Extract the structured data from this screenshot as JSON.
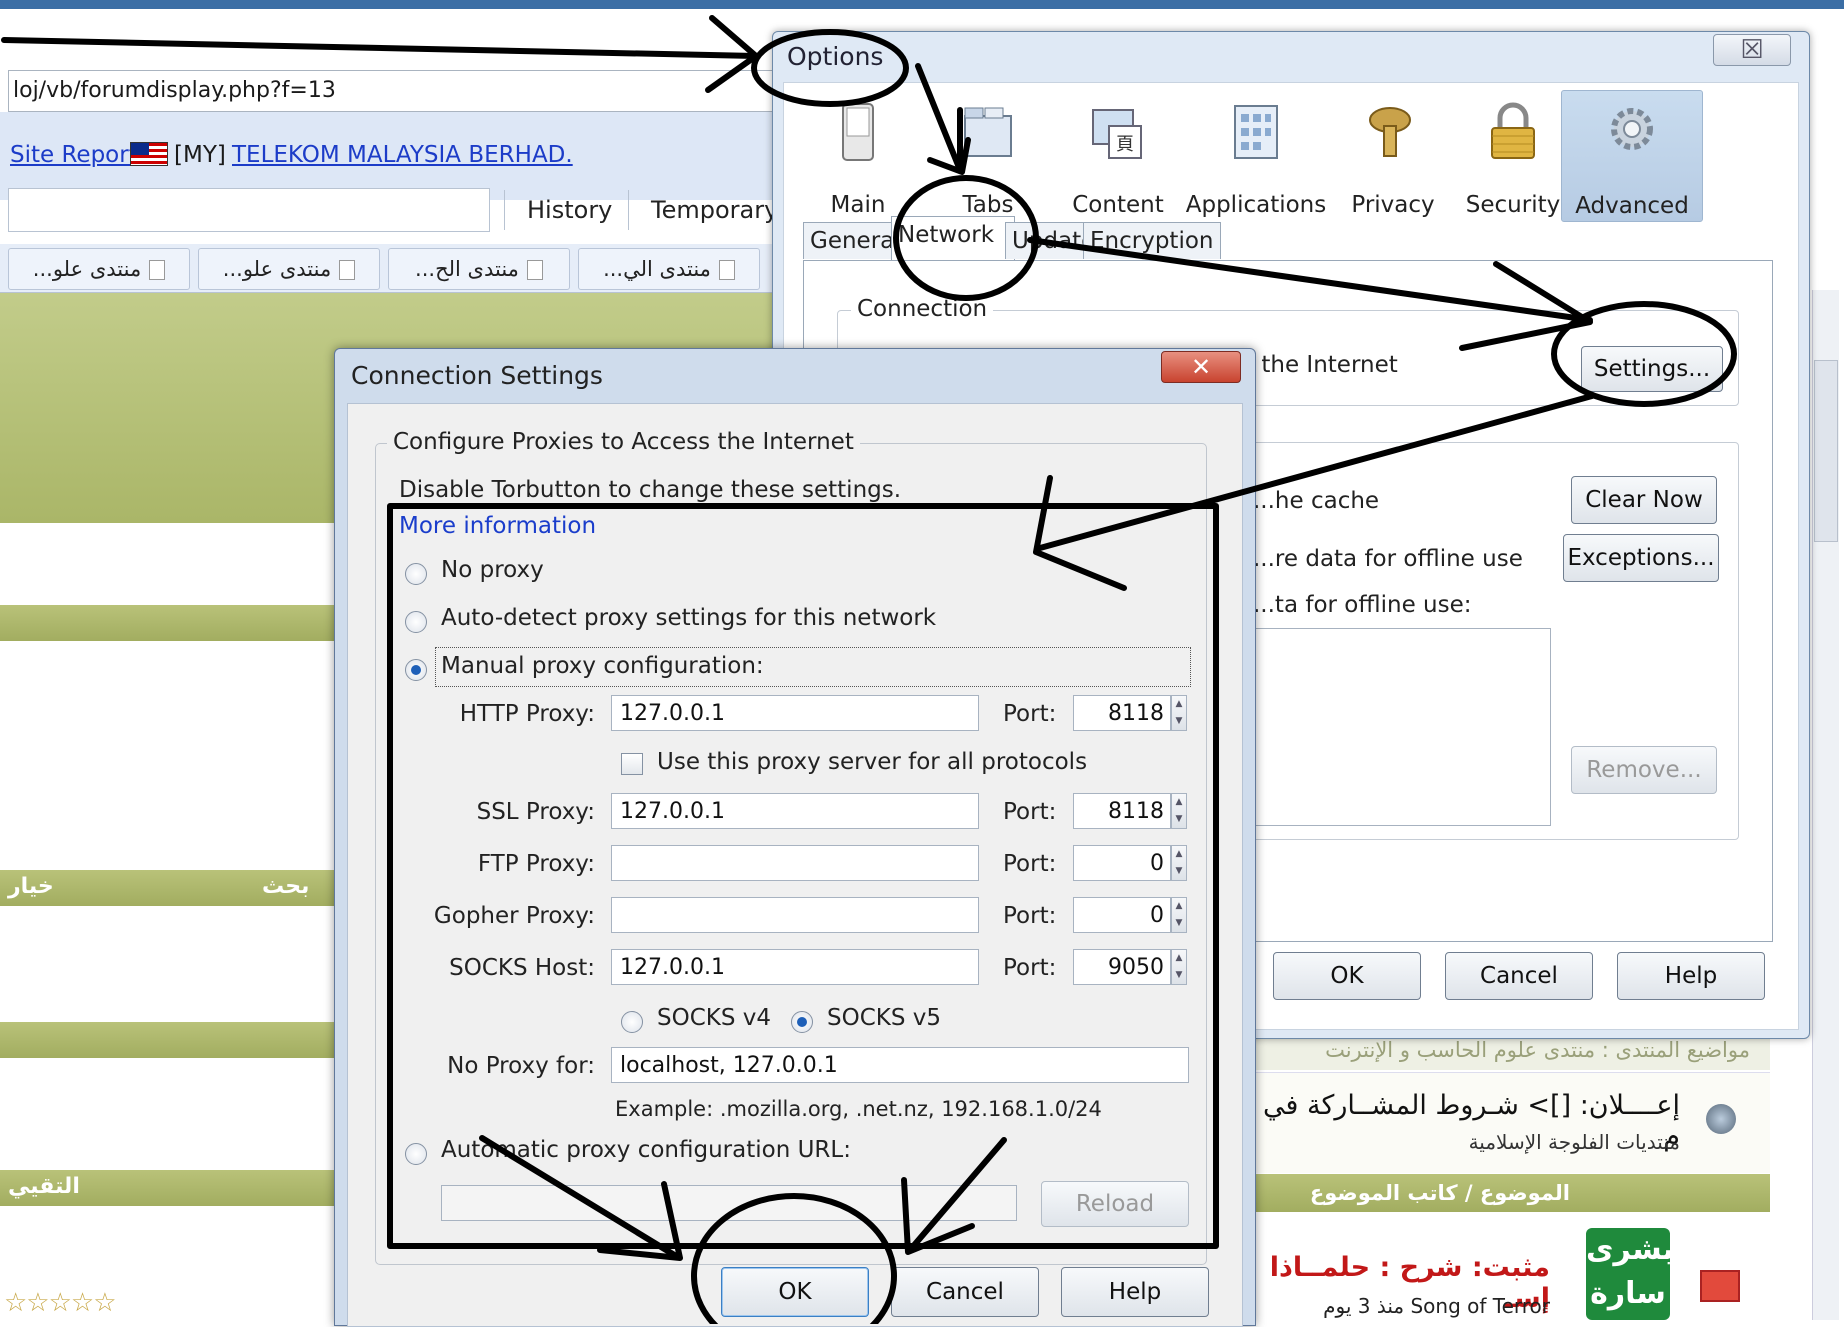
{
  "browser": {
    "url": "loj/vb/forumdisplay.php?f=13",
    "site_report": "Site Report",
    "country_code": "[MY]",
    "isp": "TELEKOM MALAYSIA BERHAD.",
    "nav_tabs": [
      "History",
      "Temporary"
    ],
    "forum_tabs": [
      "...منتدى علو",
      "...منتدى علو",
      "...منتدى الح",
      "...منتدى الي"
    ],
    "left_bar_text": [
      "خيار",
      "بحث"
    ],
    "left_col_header": "التقيي",
    "stars": "☆☆☆☆☆",
    "breadcrumb": "مواضيع المنتدى : منتدى علوم الحاسب و الإنترنت",
    "announcement_title": "إعــــلان: []> شـروط المشــاركة في م",
    "announcement_sub": "منتديات الفلوجة الإسلامية",
    "column_header": "الموضوع / كاتب الموضوع",
    "sticky_title": "مثبت: شرح : حلمــاذا إسـ",
    "sticky_author": "Song of Terror",
    "sticky_time": "منذ 3 يوم",
    "badge_text": "بشرى سارة"
  },
  "options": {
    "title": "Options",
    "close_glyph": "☒",
    "toolbar": [
      {
        "label": "Main",
        "icon": "switch-icon",
        "selected": false
      },
      {
        "label": "Tabs",
        "icon": "tabs-icon",
        "selected": false
      },
      {
        "label": "Content",
        "icon": "content-icon",
        "selected": false
      },
      {
        "label": "Applications",
        "icon": "applications-icon",
        "selected": false
      },
      {
        "label": "Privacy",
        "icon": "privacy-mask-icon",
        "selected": false
      },
      {
        "label": "Security",
        "icon": "padlock-icon",
        "selected": false
      },
      {
        "label": "Advanced",
        "icon": "gear-icon",
        "selected": true
      }
    ],
    "subtabs": [
      "General",
      "Network",
      "Update",
      "Encryption"
    ],
    "selected_subtab": "Network",
    "connection_caption": "Connection",
    "connection_text": "Configure how Firefox connects to the Internet",
    "settings_button": "Settings...",
    "cache_text": "...he cache",
    "offline_text1": "...re data for offline use",
    "offline_text2": "...ta for offline use:",
    "clear_now": "Clear Now",
    "exceptions": "Exceptions...",
    "remove": "Remove...",
    "ok": "OK",
    "cancel": "Cancel",
    "help": "Help"
  },
  "connection": {
    "title": "Connection Settings",
    "close_glyph": "✕",
    "group_caption": "Configure Proxies to Access the Internet",
    "torbutton_note": "Disable Torbutton to change these settings.",
    "more_info": "More information",
    "no_proxy": "No proxy",
    "auto_detect": "Auto-detect proxy settings for this network",
    "manual": "Manual proxy configuration:",
    "selected_mode": "manual",
    "http_label": "HTTP Proxy:",
    "http_value": "127.0.0.1",
    "http_port": "8118",
    "use_same": "Use this proxy server for all protocols",
    "use_same_checked": false,
    "ssl_label": "SSL Proxy:",
    "ssl_value": "127.0.0.1",
    "ssl_port": "8118",
    "ftp_label": "FTP Proxy:",
    "ftp_value": "",
    "ftp_port": "0",
    "gopher_label": "Gopher Proxy:",
    "gopher_value": "",
    "gopher_port": "0",
    "socks_label": "SOCKS Host:",
    "socks_value": "127.0.0.1",
    "socks_port": "9050",
    "port_label": "Port:",
    "socks_v4": "SOCKS v4",
    "socks_v5": "SOCKS v5",
    "socks_version": "v5",
    "no_proxy_label": "No Proxy for:",
    "no_proxy_value": "localhost, 127.0.0.1",
    "example": "Example: .mozilla.org, .net.nz, 192.168.1.0/24",
    "auto_url": "Automatic proxy configuration URL:",
    "auto_url_value": "",
    "reload": "Reload",
    "ok": "OK",
    "cancel": "Cancel",
    "help": "Help"
  },
  "colors": {
    "link": "#1a3dcb",
    "olive": "#aab668",
    "dialog_frame": "#cfdcec",
    "annotation": "#000000"
  }
}
